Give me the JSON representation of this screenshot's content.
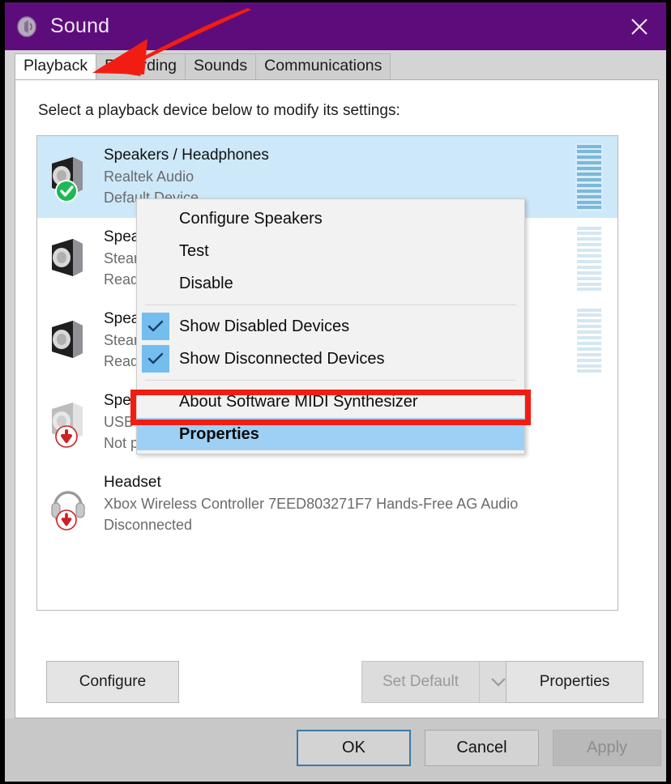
{
  "window": {
    "title": "Sound",
    "icon": "speaker-icon",
    "close_label": "✕"
  },
  "tabs": [
    {
      "label": "Playback",
      "active": true
    },
    {
      "label": "Recording",
      "active": false
    },
    {
      "label": "Sounds",
      "active": false
    },
    {
      "label": "Communications",
      "active": false
    }
  ],
  "panel": {
    "hint": "Select a playback device below to modify its settings:"
  },
  "devices": [
    {
      "name": "Speakers / Headphones",
      "subtitle": "Realtek Audio",
      "status": "Default Device",
      "icon": "speaker-icon",
      "badge": "green-check-badge",
      "selected": true,
      "meter": "active"
    },
    {
      "name": "Speakers",
      "subtitle": "Steam Streaming Speakers",
      "status": "Ready",
      "icon": "speaker-icon",
      "badge": "none",
      "selected": false,
      "meter": "faint"
    },
    {
      "name": "Speakers",
      "subtitle": "Steam Streaming Microphone",
      "status": "Ready",
      "icon": "speaker-icon",
      "badge": "none",
      "selected": false,
      "meter": "faint"
    },
    {
      "name": "Speakers",
      "subtitle": "USB Audio",
      "status": "Not plugged in",
      "icon": "speaker-disabled-icon",
      "badge": "red-down-arrow-badge",
      "selected": false,
      "meter": "none"
    },
    {
      "name": "Headset",
      "subtitle": "Xbox Wireless Controller 7EED803271F7 Hands-Free AG Audio",
      "status": "Disconnected",
      "icon": "headset-icon",
      "badge": "red-down-arrow-badge",
      "selected": false,
      "meter": "none"
    }
  ],
  "panel_buttons": {
    "configure": "Configure",
    "set_default": "Set Default",
    "set_default_disabled": true,
    "properties": "Properties"
  },
  "footer_buttons": {
    "ok": "OK",
    "cancel": "Cancel",
    "apply": "Apply",
    "apply_disabled": true
  },
  "context_menu": {
    "items": [
      {
        "label": "Configure Speakers",
        "checked": false,
        "highlighted": false
      },
      {
        "label": "Test",
        "checked": false,
        "highlighted": false
      },
      {
        "label": "Disable",
        "checked": false,
        "highlighted": false
      },
      {
        "label": "Show Disabled Devices",
        "checked": true,
        "highlighted": false
      },
      {
        "label": "Show Disconnected Devices",
        "checked": true,
        "highlighted": false
      },
      {
        "label": "About Software MIDI Synthesizer",
        "checked": false,
        "highlighted": false
      },
      {
        "label": "Properties",
        "checked": false,
        "highlighted": true
      }
    ]
  },
  "annotations": {
    "arrow_color": "#f21d12",
    "highlight_box_color": "#f21d12",
    "arrow_target": "Playback tab",
    "highlight_target": "Properties menu item"
  },
  "colors": {
    "titlebar": "#5d0d7b",
    "selection": "#cde8f9",
    "menu_highlight": "#9ed0f5",
    "accent_red": "#f21d12",
    "checkbox_blue": "#74bdef",
    "ok_focus_border": "#3a7aa8"
  }
}
